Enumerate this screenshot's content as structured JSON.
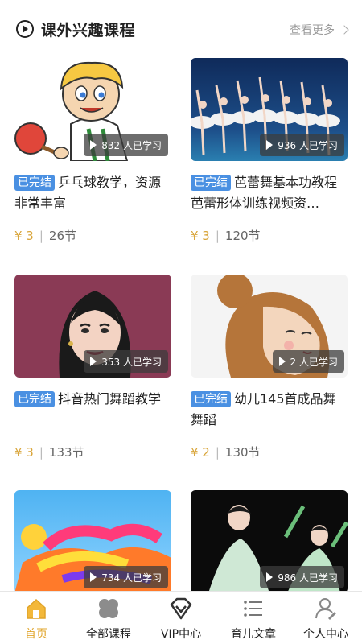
{
  "header": {
    "title": "课外兴趣课程",
    "more_label": "查看更多"
  },
  "courses": [
    {
      "badge": "已完结",
      "title": "乒乓球教学，资源非常丰富",
      "learners": "832 人已学习",
      "price": "¥ 3",
      "lessons": "26节"
    },
    {
      "badge": "已完结",
      "title": "芭蕾舞基本功教程 芭蕾形体训练视频资…",
      "learners": "936 人已学习",
      "price": "¥ 3",
      "lessons": "120节"
    },
    {
      "badge": "已完结",
      "title": "抖音热门舞蹈教学",
      "learners": "353 人已学习",
      "price": "¥ 3",
      "lessons": "133节"
    },
    {
      "badge": "已完结",
      "title": "幼儿145首成品舞舞蹈",
      "learners": "2 人已学习",
      "price": "¥ 2",
      "lessons": "130节"
    },
    {
      "learners": "734 人已学习"
    },
    {
      "learners": "986 人已学习"
    }
  ],
  "tabbar": {
    "items": [
      {
        "label": "首页",
        "icon": "home-icon",
        "active": true
      },
      {
        "label": "全部课程",
        "icon": "clover-icon",
        "active": false
      },
      {
        "label": "VIP中心",
        "icon": "diamond-icon",
        "active": false
      },
      {
        "label": "育儿文章",
        "icon": "list-icon",
        "active": false
      },
      {
        "label": "个人中心",
        "icon": "user-icon",
        "active": false
      }
    ],
    "active_color": "#e0a42a"
  },
  "colors": {
    "badge": "#4a90e2",
    "price": "#d9a53a"
  }
}
